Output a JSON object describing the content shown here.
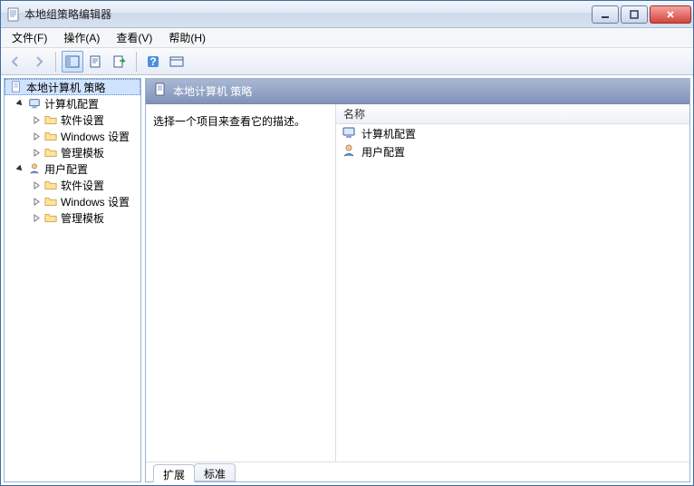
{
  "titlebar": {
    "title": "本地组策略编辑器"
  },
  "menubar": {
    "file": "文件(F)",
    "action": "操作(A)",
    "view": "查看(V)",
    "help": "帮助(H)"
  },
  "tree": {
    "root": "本地计算机 策略",
    "computer": "计算机配置",
    "computer_children": {
      "software": "软件设置",
      "windows": "Windows 设置",
      "templates": "管理模板"
    },
    "user": "用户配置",
    "user_children": {
      "software": "软件设置",
      "windows": "Windows 设置",
      "templates": "管理模板"
    }
  },
  "right": {
    "header_title": "本地计算机 策略",
    "description_prompt": "选择一个项目来查看它的描述。",
    "column_name": "名称",
    "items": {
      "computer": "计算机配置",
      "user": "用户配置"
    },
    "tabs": {
      "extended": "扩展",
      "standard": "标准"
    }
  }
}
